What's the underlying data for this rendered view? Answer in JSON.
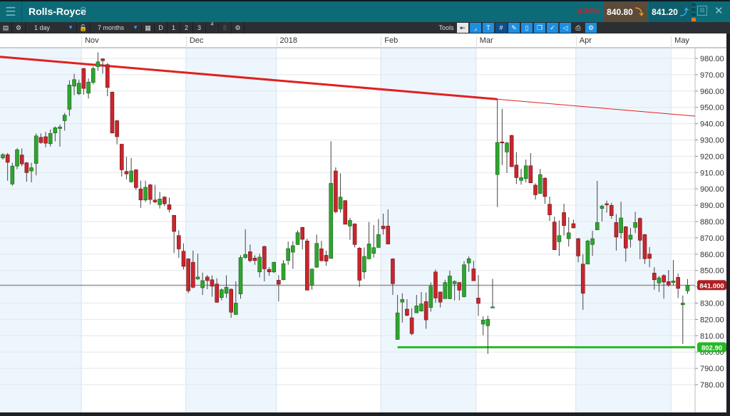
{
  "header": {
    "title": "Rolls-Royce",
    "change": "-4.29%",
    "sell": "840.80",
    "buy": "841.20",
    "icons": [
      "menu-icon",
      "search-icon",
      "restore-icon",
      "close-icon"
    ]
  },
  "toolbar": {
    "interval": "1 day",
    "range": "7 months",
    "d": "D",
    "b1": "1",
    "b2": "2",
    "b3": "3",
    "b4": "4",
    "b5": "5",
    "tools": "Tools"
  },
  "colors": {
    "up": "#2ea52e",
    "down": "#c8262e",
    "resistance": "#e02020",
    "support": "#2eb82e",
    "band": "#eef6fd"
  },
  "chart_data": {
    "type": "candlestick",
    "x_labels": [
      {
        "index": 17,
        "label": "Nov"
      },
      {
        "index": 39,
        "label": "Dec"
      },
      {
        "index": 58,
        "label": "2018"
      },
      {
        "index": 80,
        "label": "Feb"
      },
      {
        "index": 100,
        "label": "Mar"
      },
      {
        "index": 121,
        "label": "Apr"
      },
      {
        "index": 141,
        "label": "May"
      }
    ],
    "ylim": [
      775,
      985
    ],
    "y_ticks": [
      780,
      790,
      800,
      810,
      820,
      830,
      840,
      850,
      860,
      870,
      880,
      890,
      900,
      910,
      920,
      930,
      940,
      950,
      960,
      970,
      980
    ],
    "y_tick_labels": [
      "780.00",
      "790.00",
      "800.00",
      "810.00",
      "820.00",
      "830.00",
      "840.00",
      "850.00",
      "860.00",
      "870.00",
      "880.00",
      "890.00",
      "900.00",
      "910.00",
      "920.00",
      "930.00",
      "940.00",
      "950.00",
      "960.00",
      "970.00",
      "980.00"
    ],
    "last_price": 841.0,
    "last_price_label": "841.000",
    "support": {
      "value": 802.9,
      "label": "802.90",
      "from_index": 83
    },
    "resistance": {
      "from_index": 0,
      "from_value": 981,
      "to_index": 104,
      "to_value": 955,
      "extended": true
    },
    "ohlc": [
      [
        919,
        922,
        918,
        921
      ],
      [
        921,
        922,
        905,
        916.3
      ],
      [
        903,
        916,
        902,
        914
      ],
      [
        914,
        925,
        912,
        924
      ],
      [
        920.8,
        924.8,
        913.9,
        915.3
      ],
      [
        916,
        916.5,
        904.4,
        910
      ],
      [
        911,
        916,
        904,
        913
      ],
      [
        915.6,
        934,
        908.3,
        932.5
      ],
      [
        931.6,
        934,
        927.7,
        928.4
      ],
      [
        932,
        935,
        925.5,
        928
      ],
      [
        927.7,
        936.4,
        926,
        934
      ],
      [
        934.3,
        938.3,
        929.2,
        937.5
      ],
      [
        937,
        939.4,
        926,
        938
      ],
      [
        941.8,
        946.6,
        935.7,
        945.2
      ],
      [
        948.8,
        966.6,
        944.7,
        963.7
      ],
      [
        963,
        970.6,
        957.5,
        967
      ],
      [
        958.3,
        967,
        957.5,
        964.8
      ],
      [
        973.8,
        974.3,
        957.8,
        961.6
      ],
      [
        958.7,
        967.7,
        955.4,
        965.5
      ],
      [
        965.3,
        975,
        964.1,
        973.8
      ],
      [
        975,
        983.7,
        972.4,
        977.9
      ],
      [
        979.7,
        980.1,
        970.6,
        978.6
      ],
      [
        976.2,
        977.2,
        956.8,
        962.2
      ],
      [
        959.3,
        959.7,
        934,
        934.3
      ],
      [
        941.8,
        942.3,
        927.3,
        932
      ],
      [
        927.4,
        927.7,
        907.6,
        911.7
      ],
      [
        910.7,
        919.7,
        905.9,
        909.2
      ],
      [
        904.4,
        919,
        903.7,
        911
      ],
      [
        911.7,
        912,
        899.3,
        900.8
      ],
      [
        900,
        905.1,
        888.4,
        893.2
      ],
      [
        893.2,
        905,
        892,
        901
      ],
      [
        902.5,
        903,
        890.6,
        893.5
      ],
      [
        893.2,
        902.5,
        891.3,
        892
      ],
      [
        890.3,
        898.2,
        888,
        893.8
      ],
      [
        895,
        895.5,
        889.4,
        890.9
      ],
      [
        890.3,
        894.7,
        885.5,
        887.4
      ],
      [
        883.8,
        884,
        860.7,
        873.9
      ],
      [
        871.4,
        874.6,
        857.8,
        863.2
      ],
      [
        861.8,
        866.6,
        850.6,
        852.5
      ],
      [
        857.1,
        857.5,
        836,
        837.5
      ],
      [
        855,
        862.2,
        839,
        839.7
      ],
      [
        844.8,
        860.3,
        844.3,
        846
      ],
      [
        839.4,
        848.7,
        835,
        843.8
      ],
      [
        846,
        847.2,
        838.5,
        843.8
      ],
      [
        844.3,
        847,
        833.9,
        840.4
      ],
      [
        841.7,
        845.2,
        830.2,
        830.5
      ],
      [
        833.4,
        839,
        831.7,
        838.2
      ],
      [
        836,
        847,
        833.1,
        839.7
      ],
      [
        838.5,
        839,
        821,
        824.4
      ],
      [
        823,
        843.3,
        823,
        830
      ],
      [
        835.6,
        859.3,
        832.7,
        857.9
      ],
      [
        857.9,
        875.3,
        857.2,
        859.8
      ],
      [
        861.5,
        865.9,
        855,
        856
      ],
      [
        857.6,
        859.3,
        853.5,
        856.1
      ],
      [
        849.1,
        860.3,
        845.8,
        858.2
      ],
      [
        864.7,
        865.2,
        843.3,
        851
      ],
      [
        850.6,
        852,
        846.7,
        849.1
      ],
      [
        849.1,
        855.4,
        848.4,
        855
      ],
      [
        844,
        847.2,
        831,
        841.6
      ],
      [
        844.3,
        856.4,
        844,
        854.2
      ],
      [
        856.1,
        867.8,
        853.5,
        863.4
      ],
      [
        861.2,
        868,
        851,
        865.2
      ],
      [
        865.9,
        874.6,
        865.6,
        873.2
      ],
      [
        876.4,
        876.8,
        863,
        869.1
      ],
      [
        868.1,
        869.5,
        837.9,
        837.9
      ],
      [
        840.8,
        851,
        838.2,
        850.9
      ],
      [
        852,
        872,
        851.6,
        866.6
      ],
      [
        863.3,
        868.1,
        855.4,
        856
      ],
      [
        859.3,
        862.2,
        852.8,
        855.7
      ],
      [
        857.4,
        929.2,
        857.4,
        903.4
      ],
      [
        911,
        913.2,
        885.1,
        886
      ],
      [
        887.7,
        909.5,
        885.5,
        895
      ],
      [
        892.8,
        893.2,
        878.3,
        878.3
      ],
      [
        877.2,
        882.2,
        868.8,
        880.7
      ],
      [
        878.5,
        879,
        864.1,
        865.9
      ],
      [
        863.7,
        864.4,
        840,
        844
      ],
      [
        849.1,
        864.1,
        844.8,
        858.6
      ],
      [
        857.1,
        879.7,
        857.1,
        866.3
      ],
      [
        860.5,
        877.8,
        857.9,
        864
      ],
      [
        864.1,
        881.6,
        863.7,
        872
      ],
      [
        877.2,
        884.8,
        872,
        875.6
      ],
      [
        877.2,
        887.4,
        866.2,
        866.2
      ],
      [
        857.1,
        857.5,
        835,
        841.9
      ],
      [
        807.7,
        835,
        807.7,
        824
      ],
      [
        830.6,
        836,
        818.1,
        832.2
      ],
      [
        826.3,
        832.4,
        821.9,
        822.5
      ],
      [
        821,
        826.9,
        810.3,
        811.3
      ],
      [
        824,
        835,
        824,
        828.3
      ],
      [
        825.1,
        836.8,
        824.8,
        829.5
      ],
      [
        830.9,
        836.5,
        814.2,
        819.7
      ],
      [
        827.3,
        842.6,
        824.8,
        840.4
      ],
      [
        849.1,
        850.6,
        830.2,
        833.1
      ],
      [
        836.8,
        837,
        827.3,
        830.6
      ],
      [
        832.7,
        844.3,
        832.7,
        842.6
      ],
      [
        832.7,
        849.9,
        832.4,
        846.6
      ],
      [
        841.9,
        844,
        831.7,
        843.3
      ],
      [
        842.6,
        843,
        831.7,
        837.9
      ],
      [
        833.9,
        855.7,
        833.5,
        853.5
      ],
      [
        854.6,
        858.6,
        849.1,
        857.2
      ],
      [
        851,
        856,
        843.7,
        843.7
      ],
      [
        833.1,
        847.2,
        822.2,
        829.8
      ],
      [
        817.1,
        821.9,
        810.3,
        819.6
      ],
      [
        816.1,
        822.2,
        798.9,
        820
      ],
      [
        827,
        844.8,
        827,
        827.7
      ],
      [
        908.8,
        955,
        888.9,
        928.5
      ],
      [
        928.8,
        949.1,
        914.6,
        928.5
      ],
      [
        922.6,
        928.8,
        909.8,
        928.2
      ],
      [
        932.8,
        933.1,
        913.6,
        913.6
      ],
      [
        914.6,
        922.6,
        903,
        906.9
      ],
      [
        905.2,
        912.2,
        902.6,
        906.9
      ],
      [
        906.3,
        918,
        904,
        914.2
      ],
      [
        914.2,
        921.9,
        903.7,
        903.7
      ],
      [
        902.3,
        903.4,
        893.5,
        896.4
      ],
      [
        897.2,
        912.2,
        897.2,
        908.8
      ],
      [
        906.6,
        907,
        890.9,
        895.3
      ],
      [
        890.6,
        895.3,
        880.4,
        884.1
      ],
      [
        879.7,
        883,
        862.7,
        862.7
      ],
      [
        867.6,
        880.7,
        858.9,
        871.4
      ],
      [
        885.5,
        890.9,
        871.4,
        877.5
      ],
      [
        869.5,
        882.6,
        864.7,
        873.1
      ],
      [
        878.7,
        881.2,
        875.8,
        876.1
      ],
      [
        869.5,
        870,
        855,
        858.9
      ],
      [
        853.9,
        860,
        825.9,
        836
      ],
      [
        853.9,
        868.8,
        853.9,
        868.1
      ],
      [
        865.9,
        874.3,
        858.9,
        869.5
      ],
      [
        874.9,
        904.9,
        874.9,
        879.4
      ],
      [
        888,
        890.3,
        880.1,
        889.5
      ],
      [
        890.9,
        892.8,
        885.5,
        890.3
      ],
      [
        889.9,
        891.4,
        881.6,
        883.6
      ],
      [
        879.4,
        884.5,
        862.2,
        870.5
      ],
      [
        873.1,
        892.1,
        869.5,
        882.2
      ],
      [
        876.8,
        877.2,
        855.4,
        863.7
      ],
      [
        869.1,
        876.1,
        864.1,
        871.7
      ],
      [
        876.4,
        886,
        872.9,
        879.4
      ],
      [
        881.9,
        882.6,
        856.9,
        868.5
      ],
      [
        872,
        872.4,
        854,
        857.2
      ],
      [
        860.1,
        864.4,
        852,
        857.4
      ],
      [
        848.4,
        852,
        838.2,
        844.3
      ],
      [
        842.3,
        846.7,
        836.8,
        845.5
      ],
      [
        846.9,
        847.7,
        832.7,
        842.9
      ],
      [
        843.2,
        850.2,
        840,
        841.1
      ],
      [
        842.6,
        856.4,
        840.8,
        843.6
      ],
      [
        845.8,
        848.1,
        833.1,
        839
      ],
      [
        829,
        834.6,
        805,
        830
      ],
      [
        837.5,
        844.8,
        835.6,
        841
      ]
    ]
  }
}
